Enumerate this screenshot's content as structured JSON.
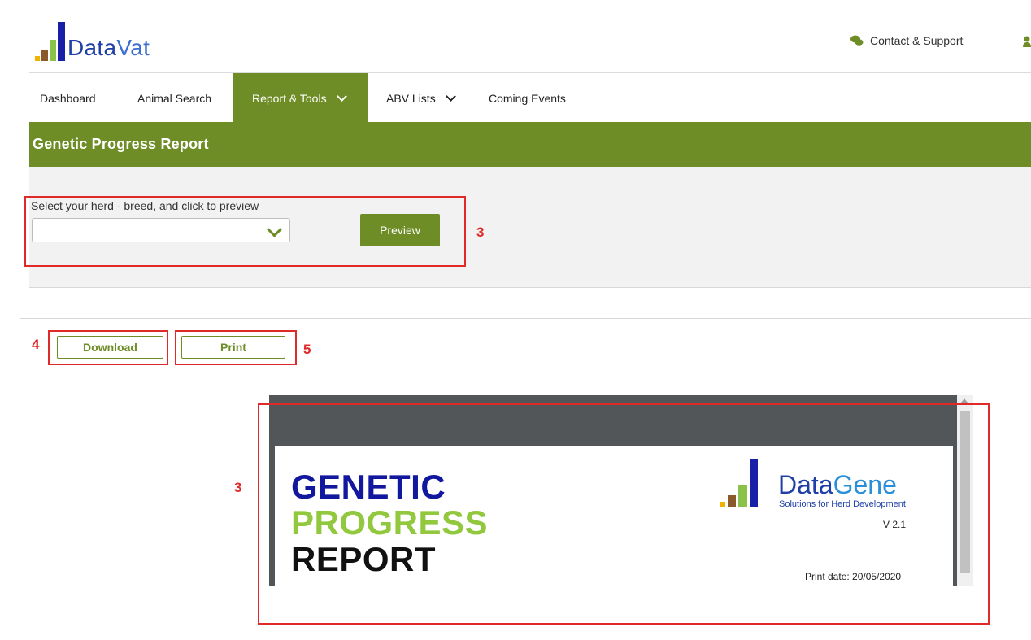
{
  "brand": {
    "logo_text_a": "Data",
    "logo_text_b": "Vat"
  },
  "header": {
    "contact_label": "Contact & Support"
  },
  "nav": {
    "items": [
      {
        "label": "Dashboard"
      },
      {
        "label": "Animal Search"
      },
      {
        "label": "Report & Tools"
      },
      {
        "label": "ABV Lists"
      },
      {
        "label": "Coming Events"
      }
    ],
    "active": "Report & Tools"
  },
  "page": {
    "title": "Genetic Progress Report"
  },
  "filter": {
    "label": "Select your herd - breed, and click to preview",
    "selected_value": "",
    "preview_label": "Preview"
  },
  "actions": {
    "download_label": "Download",
    "print_label": "Print"
  },
  "annotations": {
    "a1": "3",
    "a2": "3",
    "a3": "4",
    "a4": "5"
  },
  "report": {
    "title_line1": "GENETIC",
    "title_line2": "PROGRESS",
    "title_line3": "REPORT",
    "brand_a": "Data",
    "brand_b": "Gene",
    "brand_tagline": "Solutions for Herd Development",
    "version": "V 2.1",
    "print_date": "Print date: 20/05/2020"
  },
  "colors": {
    "accent": "#6e8d27",
    "annotation_red": "#e02a2a",
    "title_blue": "#12189e",
    "title_green": "#92c83e"
  }
}
